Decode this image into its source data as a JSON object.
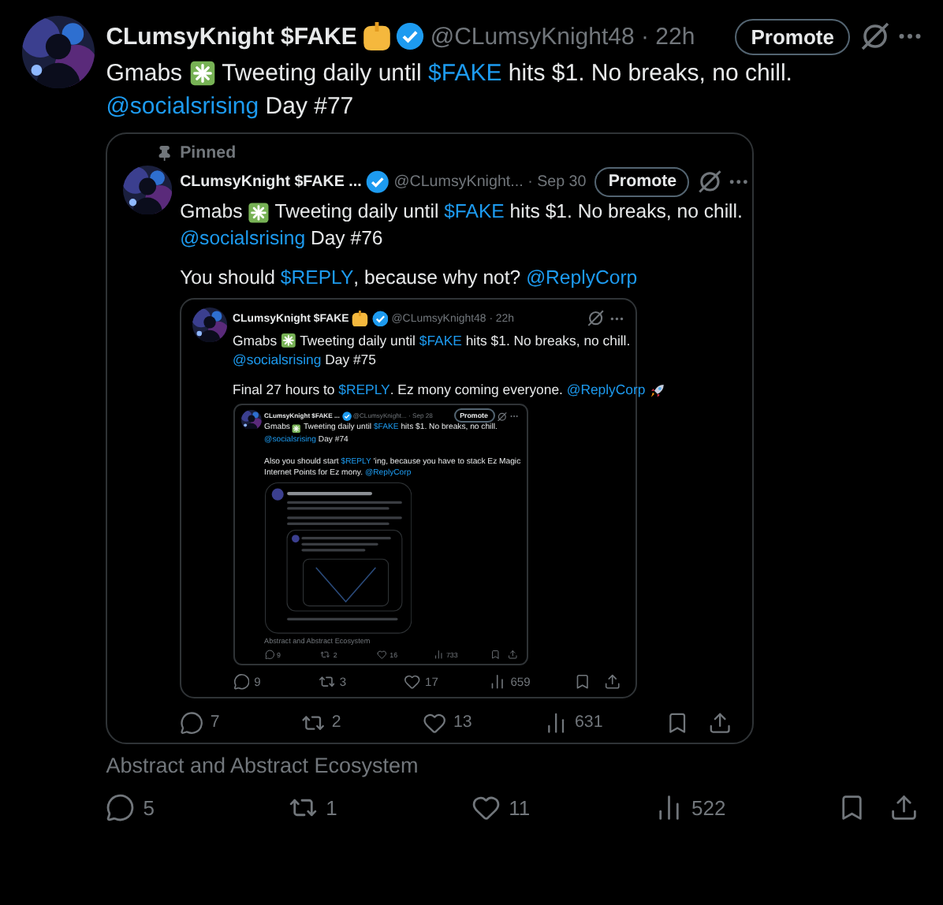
{
  "post": {
    "name": "CLumsyKnight $FAKE",
    "hand_emoji": true,
    "verified": true,
    "meta": "@CLumsyKnight48 · 22h",
    "promote": "Promote",
    "paragraphs": [
      {
        "lines": [
          [
            {
              "kind": "text",
              "text": "Gmabs "
            },
            {
              "kind": "sparkle"
            },
            {
              "kind": "text",
              "text": " Tweeting daily until "
            },
            {
              "kind": "link",
              "text": "$FAKE"
            },
            {
              "kind": "text",
              "text": " hits $1. No breaks, no chill."
            }
          ],
          [
            {
              "kind": "link",
              "text": "@socialsrising"
            },
            {
              "kind": "text",
              "text": " Day #77"
            }
          ]
        ]
      }
    ],
    "quote": {
      "kind": "post",
      "pinned": "Pinned",
      "name": "CLumsyKnight $FAKE ...",
      "hand_emoji": false,
      "verified": true,
      "meta": "@CLumsyKnight... · Sep 30",
      "promote": "Promote",
      "paragraphs": [
        {
          "lines": [
            [
              {
                "kind": "text",
                "text": "Gmabs "
              },
              {
                "kind": "sparkle"
              },
              {
                "kind": "text",
                "text": " Tweeting daily until "
              },
              {
                "kind": "link",
                "text": "$FAKE"
              },
              {
                "kind": "text",
                "text": " hits $1. No breaks, no chill."
              }
            ],
            [
              {
                "kind": "link",
                "text": "@socialsrising"
              },
              {
                "kind": "text",
                "text": " Day #76"
              }
            ]
          ]
        },
        {
          "lines": [
            [
              {
                "kind": "text",
                "text": "You should "
              },
              {
                "kind": "link",
                "text": "$REPLY"
              },
              {
                "kind": "text",
                "text": ", because why not? "
              },
              {
                "kind": "link",
                "text": "@ReplyCorp"
              }
            ]
          ]
        }
      ],
      "quote": {
        "kind": "post",
        "name": "CLumsyKnight $FAKE",
        "hand_emoji": true,
        "verified": true,
        "meta": "@CLumsyKnight48 · 22h",
        "paragraphs": [
          {
            "lines": [
              [
                {
                  "kind": "text",
                  "text": "Gmabs "
                },
                {
                  "kind": "sparkle"
                },
                {
                  "kind": "text",
                  "text": " Tweeting daily until "
                },
                {
                  "kind": "link",
                  "text": "$FAKE"
                },
                {
                  "kind": "text",
                  "text": " hits $1. No breaks, no chill."
                }
              ],
              [
                {
                  "kind": "link",
                  "text": "@socialsrising"
                },
                {
                  "kind": "text",
                  "text": " Day #75"
                }
              ]
            ]
          },
          {
            "lines": [
              [
                {
                  "kind": "text",
                  "text": "Final 27 hours to "
                },
                {
                  "kind": "link",
                  "text": "$REPLY"
                },
                {
                  "kind": "text",
                  "text": ". Ez mony coming everyone. "
                },
                {
                  "kind": "link",
                  "text": "@ReplyCorp"
                },
                {
                  "kind": "rocket"
                }
              ]
            ]
          }
        ],
        "quote": {
          "kind": "post",
          "name": "CLumsyKnight $FAKE ...",
          "hand_emoji": false,
          "verified": true,
          "meta": "@CLumsyKnight... · Sep 28",
          "promote": "Promote",
          "paragraphs": [
            {
              "lines": [
                [
                  {
                    "kind": "text",
                    "text": "Gmabs "
                  },
                  {
                    "kind": "sparkle"
                  },
                  {
                    "kind": "text",
                    "text": " Tweeting daily until "
                  },
                  {
                    "kind": "link",
                    "text": "$FAKE"
                  },
                  {
                    "kind": "text",
                    "text": " hits $1. No breaks, no chill."
                  }
                ],
                [
                  {
                    "kind": "link",
                    "text": "@socialsrising"
                  },
                  {
                    "kind": "text",
                    "text": " Day #74"
                  }
                ]
              ]
            },
            {
              "lines": [
                [
                  {
                    "kind": "text",
                    "text": "Also you should start "
                  },
                  {
                    "kind": "link",
                    "text": "$REPLY"
                  },
                  {
                    "kind": "text",
                    "text": " 'ing, because you have to stack Ez Magic"
                  }
                ],
                [
                  {
                    "kind": "text",
                    "text": "Internet Points for Ez mony. "
                  },
                  {
                    "kind": "link",
                    "text": "@ReplyCorp"
                  }
                ]
              ]
            }
          ],
          "quote": {
            "kind": "preview"
          },
          "community": "Abstract and Abstract Ecosystem",
          "actions": [
            {
              "kind": "reply",
              "count": "9"
            },
            {
              "kind": "repost",
              "count": "2"
            },
            {
              "kind": "like",
              "count": "16"
            },
            {
              "kind": "views",
              "count": "733"
            },
            {
              "kind": "bookmark"
            },
            {
              "kind": "share"
            }
          ]
        },
        "actions": [
          {
            "kind": "reply",
            "count": "9"
          },
          {
            "kind": "repost",
            "count": "3"
          },
          {
            "kind": "like",
            "count": "17"
          },
          {
            "kind": "views",
            "count": "659"
          },
          {
            "kind": "bookmark"
          },
          {
            "kind": "share"
          }
        ]
      },
      "actions": [
        {
          "kind": "reply",
          "count": "7"
        },
        {
          "kind": "repost",
          "count": "2"
        },
        {
          "kind": "like",
          "count": "13"
        },
        {
          "kind": "views",
          "count": "631"
        },
        {
          "kind": "bookmark"
        },
        {
          "kind": "share"
        }
      ]
    },
    "community": "Abstract and Abstract Ecosystem",
    "actions": [
      {
        "kind": "reply",
        "count": "5"
      },
      {
        "kind": "repost",
        "count": "1"
      },
      {
        "kind": "like",
        "count": "11"
      },
      {
        "kind": "views",
        "count": "522"
      },
      {
        "kind": "bookmark"
      },
      {
        "kind": "share"
      }
    ]
  }
}
